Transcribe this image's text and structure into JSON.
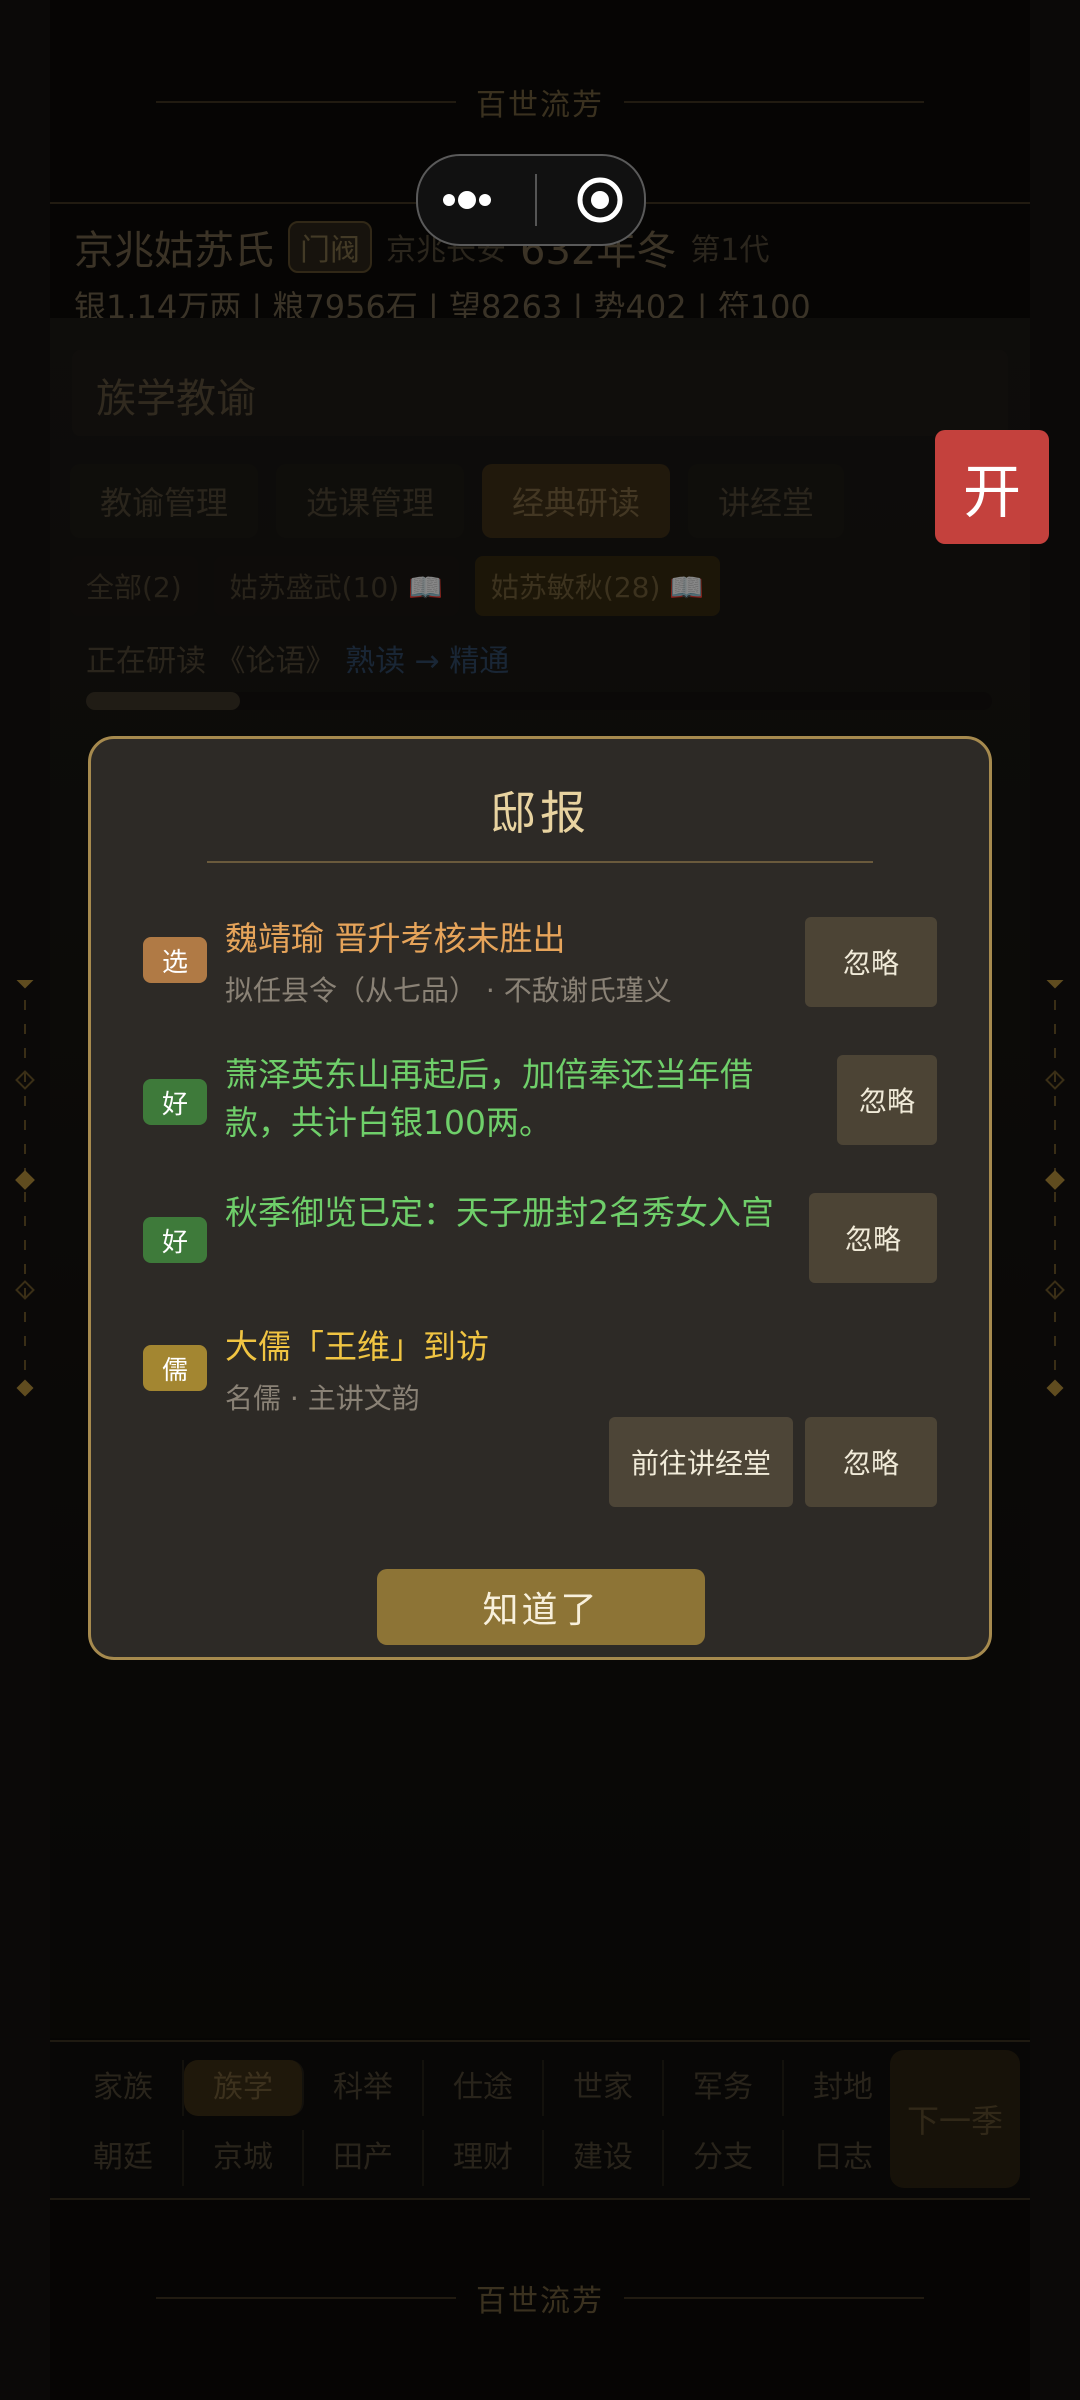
{
  "banner": {
    "title": "百世流芳"
  },
  "mini_program": {
    "more": "•••",
    "close": "⦿"
  },
  "header": {
    "clan": "京兆姑苏氏",
    "rank": "门阀",
    "location": "京兆长安",
    "year": "632年冬",
    "generation": "第1代"
  },
  "stats": "银1.14万两 | 粮7956石 | 望8263 | 势402 | 符100",
  "panel": {
    "title": "族学教谕",
    "tabs": [
      "教谕管理",
      "选课管理",
      "经典研读",
      "讲经堂"
    ],
    "chips": [
      "全部(2)",
      "姑苏盛武(10) 📖",
      "姑苏敏秋(28) 📖"
    ],
    "reading_prefix": "正在研读",
    "reading_book": "《论语》",
    "reading_stage": "熟读 → 精通",
    "progress": 0.17
  },
  "float_button": {
    "label": "开"
  },
  "modal": {
    "title": "邸报",
    "items": [
      {
        "tag": "选",
        "title": "魏靖瑜 晋升考核未胜出",
        "sub": "拟任县令（从七品） · 不敌谢氏瑾义",
        "ignore": "忽略"
      },
      {
        "tag": "好",
        "title": "萧泽英东山再起后，加倍奉还当年借款，共计白银100两。",
        "ignore": "忽略"
      },
      {
        "tag": "好",
        "title": "秋季御览已定：天子册封2名秀女入宫",
        "ignore": "忽略"
      },
      {
        "tag": "儒",
        "title": "大儒「王维」到访",
        "sub": "名儒 · 主讲文韵",
        "goto": "前往讲经堂",
        "ignore": "忽略"
      }
    ],
    "ok": "知道了"
  },
  "nav": {
    "row1": [
      "家族",
      "族学",
      "科举",
      "仕途",
      "世家",
      "军务",
      "封地"
    ],
    "row2": [
      "朝廷",
      "京城",
      "田产",
      "理财",
      "建设",
      "分支",
      "日志"
    ],
    "next": "下一季"
  },
  "colors": {
    "accent_gold": "#a68a4e",
    "tag_select": "#b07a45",
    "tag_good": "#3e7a3a",
    "tag_scholar": "#a38631",
    "text_orange": "#e6a45a",
    "text_green": "#6fcf6a",
    "text_yellow": "#f0c442",
    "float_red": "#c4413d"
  }
}
